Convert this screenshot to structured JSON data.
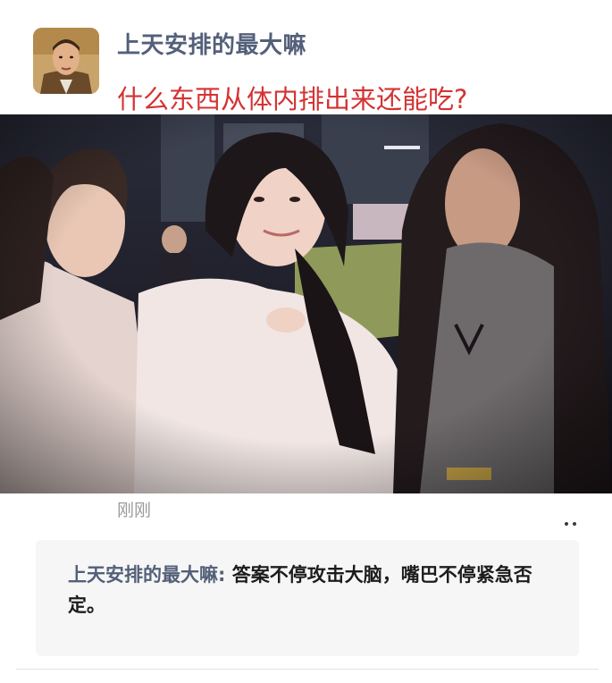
{
  "post": {
    "author_name": "上天安排的最大嘛",
    "text": "什么东西从体内排出来还能吃?",
    "timestamp": "刚刚",
    "avatar_icon": "profile-photo",
    "more_icon": "more-dots-icon"
  },
  "comments": [
    {
      "author": "上天安排的最大嘛",
      "separator": ": ",
      "text": "答案不停攻击大脑，嘴巴不停紧急否定。"
    }
  ],
  "colors": {
    "author_name": "#54607a",
    "post_text": "#d43333",
    "timestamp": "#9a9a9a",
    "comment_bg": "#f6f6f6"
  }
}
